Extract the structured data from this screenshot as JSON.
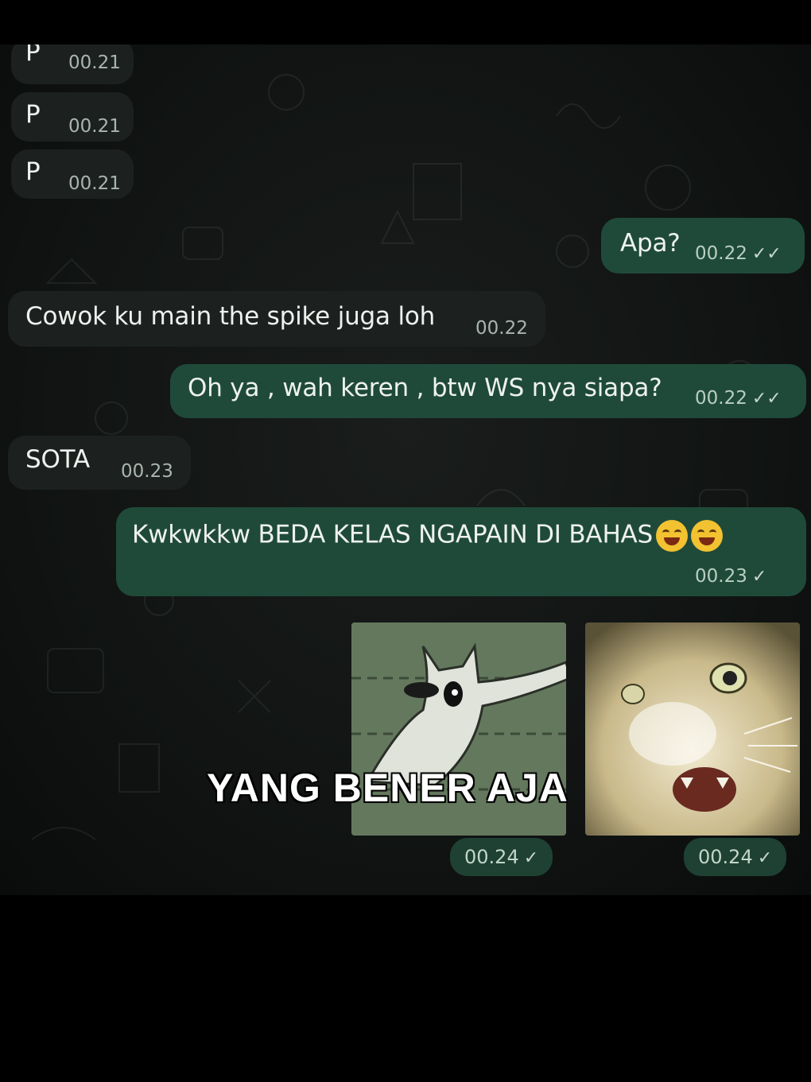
{
  "messages": [
    {
      "side": "in",
      "text": "P",
      "time": "00.21"
    },
    {
      "side": "in",
      "text": "P",
      "time": "00.21"
    },
    {
      "side": "in",
      "text": "P",
      "time": "00.21"
    },
    {
      "side": "out",
      "text": "Apa?",
      "time": "00.22",
      "ticks": "✓✓"
    },
    {
      "side": "in",
      "text": "Cowok ku main the spike juga loh",
      "time": "00.22"
    },
    {
      "side": "out",
      "text": "Oh ya , wah keren , btw WS nya siapa?",
      "time": "00.22",
      "ticks": "✓✓"
    },
    {
      "side": "in",
      "text": "SOTA",
      "time": "00.23"
    },
    {
      "side": "out",
      "text": "Kwkwkkw BEDA KELAS NGAPAIN DI BAHAS",
      "emojis": [
        "crying-laughing-emoji",
        "laughing-emoji"
      ],
      "time": "00.23",
      "ticks": "✓"
    }
  ],
  "stickers": [
    {
      "name": "pointing-cat-sticker",
      "time": "00.24",
      "ticks": "✓"
    },
    {
      "name": "shocked-cat-sticker",
      "time": "00.24",
      "ticks": "✓"
    }
  ],
  "caption": "YANG BENER AJA"
}
